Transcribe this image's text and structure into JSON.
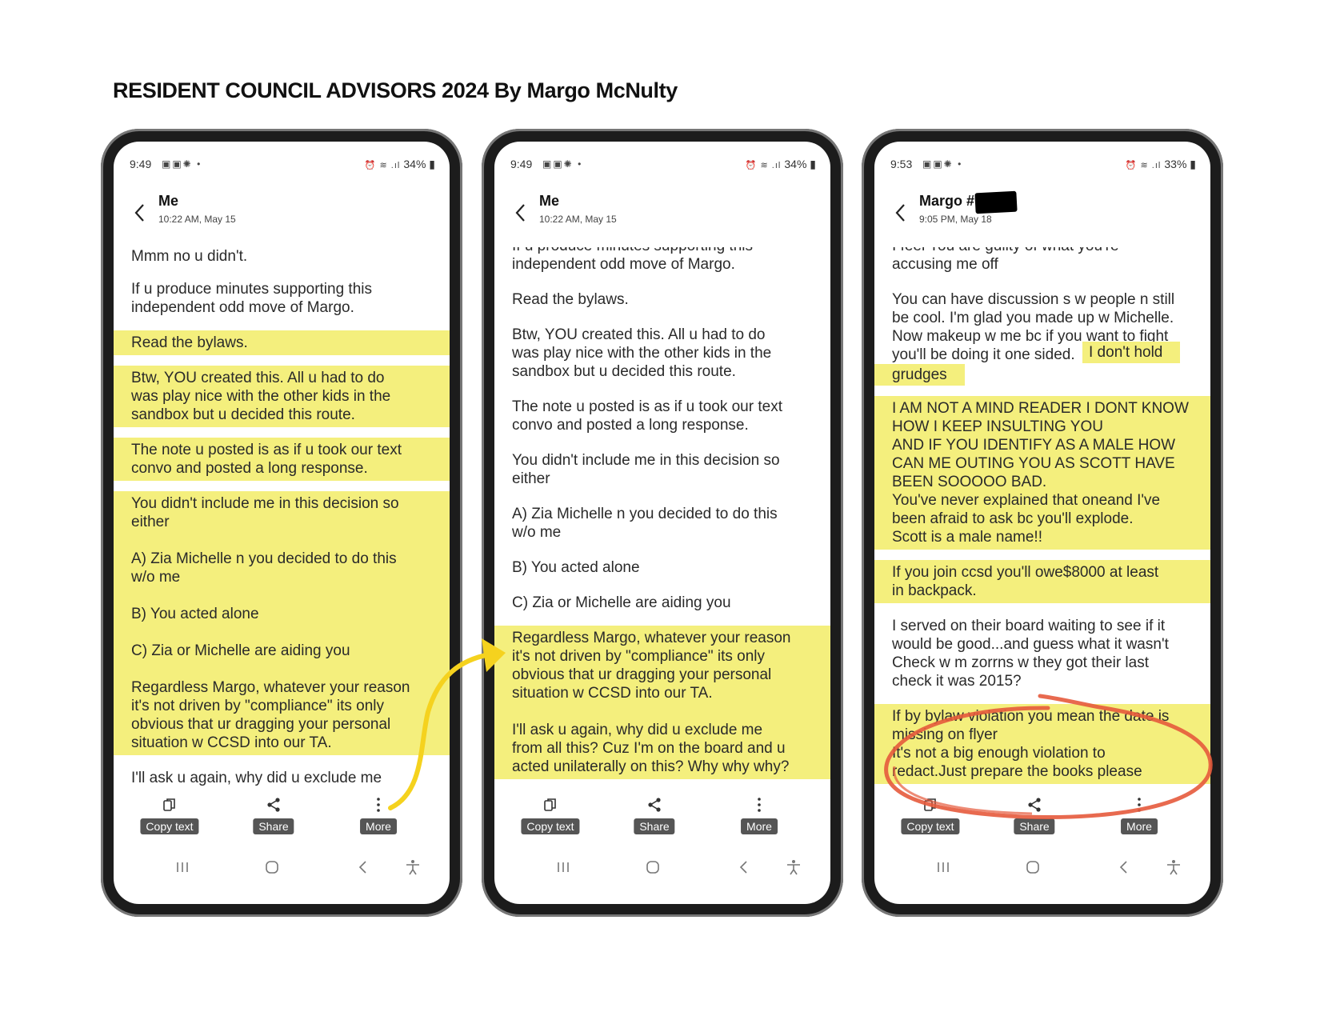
{
  "document_title": "RESIDENT COUNCIL ADVISORS 2024 By Margo McNulty",
  "colors": {
    "highlight": "#f4ef7d",
    "arrow": "#f5d21e",
    "circle": "#e55a3c",
    "phone_frame": "#1c1c1c"
  },
  "phones": [
    {
      "status": {
        "time": "9:49",
        "battery": "34%"
      },
      "contact": {
        "name": "Me",
        "timestamp": "10:22 AM, May 15"
      },
      "messages": [
        "Mmm no u didn't.",
        "If u produce minutes supporting this\nindependent odd move of Margo.",
        "Read the bylaws.",
        "Btw, YOU created this. All u had to do\nwas play nice with the other kids in the\nsandbox but u decided this route.",
        "The note u posted is as if u took our text\nconvo and posted a long response.",
        "You didn't include me in this decision so\neither\n\nA) Zia Michelle n you decided to do this\nw/o me\n\nB) You acted alone\n\nC) Zia or Michelle are aiding you\n\nRegardless Margo, whatever your reason\nit's not driven by \"compliance\" its only\nobvious that ur dragging your personal\nsituation w CCSD into our TA.",
        "I'll ask u again, why did u exclude me"
      ],
      "toolbar": {
        "copy": "Copy text",
        "share": "Share",
        "more": "More"
      }
    },
    {
      "status": {
        "time": "9:49",
        "battery": "34%"
      },
      "contact": {
        "name": "Me",
        "timestamp": "10:22 AM, May 15"
      },
      "messages": [
        "If u produce minutes supporting this\nindependent odd move of Margo.",
        "Read the bylaws.",
        "Btw, YOU created this. All u had to do\nwas play nice with the other kids in the\nsandbox but u decided this route.",
        "The note u posted is as if u took our text\nconvo and posted a long response.",
        "You didn't include me in this decision so\neither",
        "A) Zia Michelle n you decided to do this\nw/o me",
        "B) You acted alone",
        "C) Zia or Michelle are aiding you",
        "Regardless Margo, whatever your reason\nit's not driven by \"compliance\" its only\nobvious that ur dragging your personal\nsituation w CCSD into our TA.\n\nI'll ask u again, why did u exclude me\nfrom all this? Cuz I'm on the board and u\nacted unilaterally on this? Why why why?"
      ],
      "toolbar": {
        "copy": "Copy text",
        "share": "Share",
        "more": "More"
      }
    },
    {
      "status": {
        "time": "9:53",
        "battery": "33%"
      },
      "contact": {
        "name": "Margo #",
        "timestamp": "9:05 PM, May 18"
      },
      "messages": [
        "I feel You are guilty of what you're\naccusing me off",
        "You can have discussion s w people n still\nbe cool. I'm glad you made up w Michelle.\nNow makeup w me bc if you want to fight\nyou'll be doing it one sided.",
        "I don't hold",
        "grudges",
        "I AM NOT A MIND READER I DONT KNOW\nHOW I KEEP INSULTING YOU\nAND IF YOU IDENTIFY AS A MALE HOW\nCAN ME OUTING YOU AS SCOTT HAVE\nBEEN SOOOOO BAD.\nYou've never explained that oneand I've\nbeen afraid to ask bc you'll explode.\nScott is a male name!!",
        "If you join ccsd you'll owe$8000 at least\nin backpack.",
        "I served on their board waiting to see if it\nwould be good...and guess what it wasn't\nCheck w m zorrns w they got their last\ncheck it was 2015?",
        "If by bylaw violation you mean the date is\nmissing on flyer\nIt's not a big enough violation to\nredact.Just prepare the books please"
      ],
      "toolbar": {
        "copy": "Copy text",
        "share": "Share",
        "more": "More"
      }
    }
  ]
}
